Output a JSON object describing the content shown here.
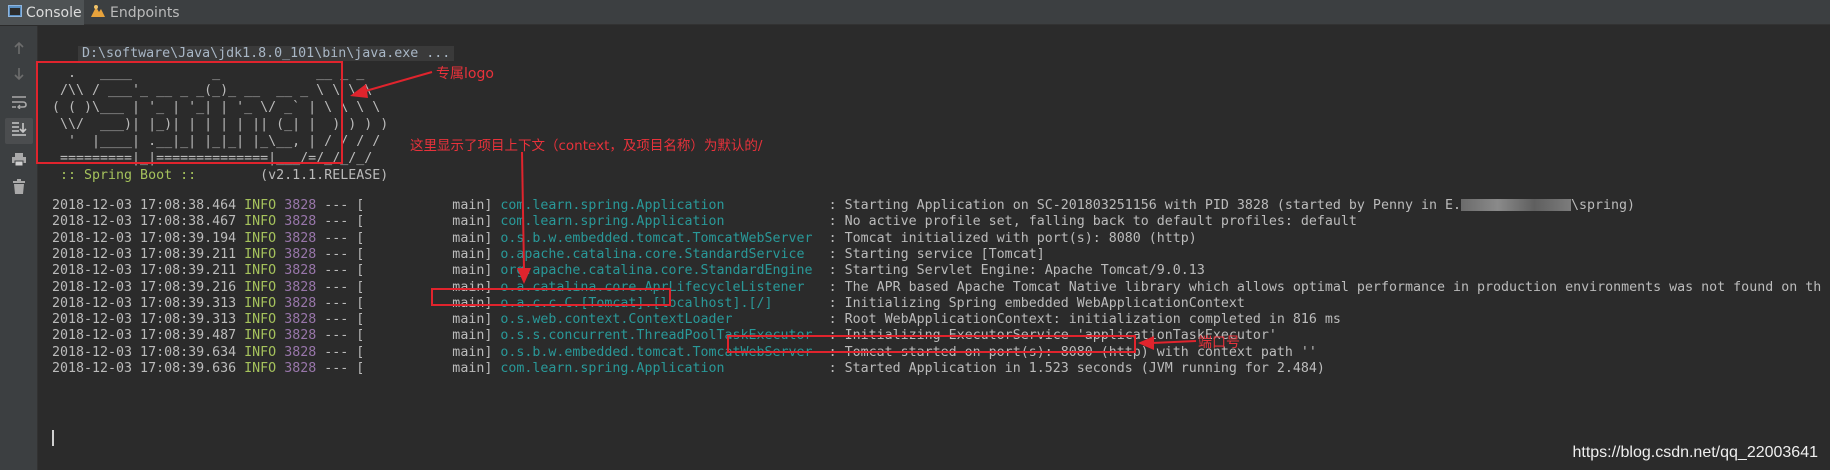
{
  "tabs": [
    {
      "label": "Console",
      "icon": "console-icon",
      "active": true
    },
    {
      "label": "Endpoints",
      "icon": "endpoints-icon",
      "active": false
    }
  ],
  "toolbar": {
    "icons": [
      "arrow-up-icon",
      "arrow-down-icon",
      "soft-wrap-icon",
      "scroll-to-end-icon",
      "print-icon",
      "trash-icon"
    ]
  },
  "console": {
    "command": "D:\\software\\Java\\jdk1.8.0_101\\bin\\java.exe ...",
    "banner": [
      "  .   ____          _            __ _ _",
      " /\\\\ / ___'_ __ _ _(_)_ __  __ _ \\ \\ \\ \\",
      "( ( )\\___ | '_ | '_| | '_ \\/ _` | \\ \\ \\ \\",
      " \\\\/  ___)| |_)| | | | | || (_| |  ) ) ) )",
      "  '  |____| .__|_| |_|_| |_\\__, | / / / /",
      " =========|_|==============|___/=/_/_/_/"
    ],
    "spring_label": " :: Spring Boot :: ",
    "spring_version": "       (v2.1.1.RELEASE)",
    "log": [
      {
        "ts": "2018-12-03 17:08:38.464",
        "level": "INFO",
        "pid": "3828",
        "thread": " --- [           main] ",
        "logger": "com.learn.spring.Application            ",
        "msg": " : Starting Application on SC-201803251156 with PID 3828 (started by Penny in E.",
        "msg2": "\\spring)"
      },
      {
        "ts": "2018-12-03 17:08:38.467",
        "level": "INFO",
        "pid": "3828",
        "thread": " --- [           main] ",
        "logger": "com.learn.spring.Application            ",
        "msg": " : No active profile set, falling back to default profiles: default"
      },
      {
        "ts": "2018-12-03 17:08:39.194",
        "level": "INFO",
        "pid": "3828",
        "thread": " --- [           main] ",
        "logger": "o.s.b.w.embedded.tomcat.TomcatWebServer ",
        "msg": " : Tomcat initialized with port(s): 8080 (http)"
      },
      {
        "ts": "2018-12-03 17:08:39.211",
        "level": "INFO",
        "pid": "3828",
        "thread": " --- [           main] ",
        "logger": "o.apache.catalina.core.StandardService  ",
        "msg": " : Starting service [Tomcat]"
      },
      {
        "ts": "2018-12-03 17:08:39.211",
        "level": "INFO",
        "pid": "3828",
        "thread": " --- [           main] ",
        "logger": "org.apache.catalina.core.StandardEngine ",
        "msg": " : Starting Servlet Engine: Apache Tomcat/9.0.13"
      },
      {
        "ts": "2018-12-03 17:08:39.216",
        "level": "INFO",
        "pid": "3828",
        "thread": " --- [           main] ",
        "logger": "o.a.catalina.core.AprLifecycleListener  ",
        "msg": " : The APR based Apache Tomcat Native library which allows optimal performance in production environments was not found on th"
      },
      {
        "ts": "2018-12-03 17:08:39.313",
        "level": "INFO",
        "pid": "3828",
        "thread": " --- [           main] ",
        "logger": "o.a.c.c.C.[Tomcat].[localhost].[/]      ",
        "msg": " : Initializing Spring embedded WebApplicationContext"
      },
      {
        "ts": "2018-12-03 17:08:39.313",
        "level": "INFO",
        "pid": "3828",
        "thread": " --- [           main] ",
        "logger": "o.s.web.context.ContextLoader           ",
        "msg": " : Root WebApplicationContext: initialization completed in 816 ms"
      },
      {
        "ts": "2018-12-03 17:08:39.487",
        "level": "INFO",
        "pid": "3828",
        "thread": " --- [           main] ",
        "logger": "o.s.s.concurrent.ThreadPoolTaskExecutor ",
        "msg": " : Initializing ExecutorService 'applicationTaskExecutor'"
      },
      {
        "ts": "2018-12-03 17:08:39.634",
        "level": "INFO",
        "pid": "3828",
        "thread": " --- [           main] ",
        "logger": "o.s.b.w.embedded.tomcat.TomcatWebServer ",
        "msg": " : Tomcat started on port(s): 8080 (http) with context path ''"
      },
      {
        "ts": "2018-12-03 17:08:39.636",
        "level": "INFO",
        "pid": "3828",
        "thread": " --- [           main] ",
        "logger": "com.learn.spring.Application            ",
        "msg": " : Started Application in 1.523 seconds (JVM running for 2.484)"
      }
    ]
  },
  "annotations": {
    "logo": "专属logo",
    "context": "这里显示了项目上下文（context，及项目名称）为默认的/",
    "port": "端口号",
    "color": "#e0242d"
  },
  "watermark": "https://blog.csdn.net/qq_22003641"
}
